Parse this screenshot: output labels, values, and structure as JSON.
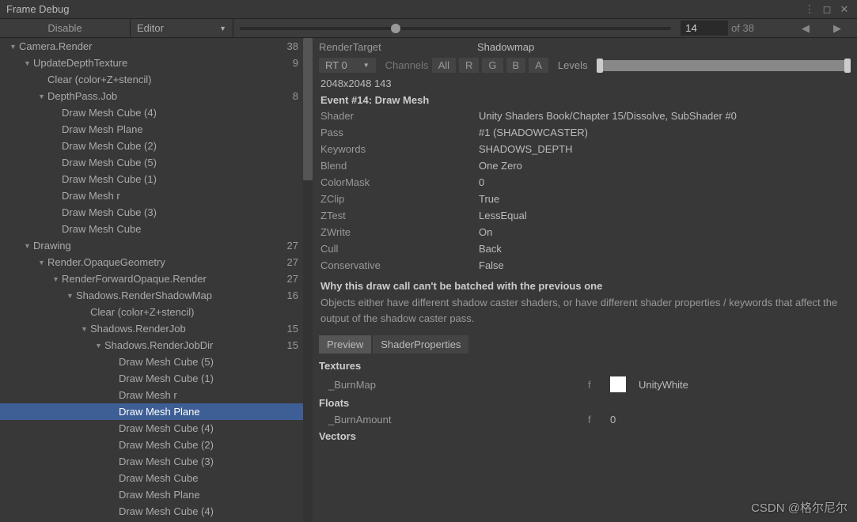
{
  "window": {
    "title": "Frame Debug"
  },
  "toolbar": {
    "disable": "Disable",
    "target": "Editor",
    "current_frame": "14",
    "total_frames": "of 38"
  },
  "tree": [
    {
      "indent": 0,
      "fold": true,
      "label": "Camera.Render",
      "count": "38"
    },
    {
      "indent": 1,
      "fold": true,
      "label": "UpdateDepthTexture",
      "count": "9"
    },
    {
      "indent": 2,
      "fold": false,
      "label": "Clear (color+Z+stencil)",
      "count": ""
    },
    {
      "indent": 2,
      "fold": true,
      "label": "DepthPass.Job",
      "count": "8"
    },
    {
      "indent": 3,
      "fold": false,
      "label": "Draw Mesh Cube (4)",
      "count": ""
    },
    {
      "indent": 3,
      "fold": false,
      "label": "Draw Mesh Plane",
      "count": ""
    },
    {
      "indent": 3,
      "fold": false,
      "label": "Draw Mesh Cube (2)",
      "count": ""
    },
    {
      "indent": 3,
      "fold": false,
      "label": "Draw Mesh Cube (5)",
      "count": ""
    },
    {
      "indent": 3,
      "fold": false,
      "label": "Draw Mesh Cube (1)",
      "count": ""
    },
    {
      "indent": 3,
      "fold": false,
      "label": "Draw Mesh r",
      "count": ""
    },
    {
      "indent": 3,
      "fold": false,
      "label": "Draw Mesh Cube (3)",
      "count": ""
    },
    {
      "indent": 3,
      "fold": false,
      "label": "Draw Mesh Cube",
      "count": ""
    },
    {
      "indent": 1,
      "fold": true,
      "label": "Drawing",
      "count": "27"
    },
    {
      "indent": 2,
      "fold": true,
      "label": "Render.OpaqueGeometry",
      "count": "27"
    },
    {
      "indent": 3,
      "fold": true,
      "label": "RenderForwardOpaque.Render",
      "count": "27"
    },
    {
      "indent": 4,
      "fold": true,
      "label": "Shadows.RenderShadowMap",
      "count": "16"
    },
    {
      "indent": 5,
      "fold": false,
      "label": "Clear (color+Z+stencil)",
      "count": ""
    },
    {
      "indent": 5,
      "fold": true,
      "label": "Shadows.RenderJob",
      "count": "15"
    },
    {
      "indent": 6,
      "fold": true,
      "label": "Shadows.RenderJobDir",
      "count": "15"
    },
    {
      "indent": 7,
      "fold": false,
      "label": "Draw Mesh Cube (5)",
      "count": ""
    },
    {
      "indent": 7,
      "fold": false,
      "label": "Draw Mesh Cube (1)",
      "count": ""
    },
    {
      "indent": 7,
      "fold": false,
      "label": "Draw Mesh r",
      "count": ""
    },
    {
      "indent": 7,
      "fold": false,
      "label": "Draw Mesh Plane",
      "count": "",
      "selected": true
    },
    {
      "indent": 7,
      "fold": false,
      "label": "Draw Mesh Cube (4)",
      "count": ""
    },
    {
      "indent": 7,
      "fold": false,
      "label": "Draw Mesh Cube (2)",
      "count": ""
    },
    {
      "indent": 7,
      "fold": false,
      "label": "Draw Mesh Cube (3)",
      "count": ""
    },
    {
      "indent": 7,
      "fold": false,
      "label": "Draw Mesh Cube",
      "count": ""
    },
    {
      "indent": 7,
      "fold": false,
      "label": "Draw Mesh Plane",
      "count": ""
    },
    {
      "indent": 7,
      "fold": false,
      "label": "Draw Mesh Cube (4)",
      "count": ""
    }
  ],
  "details": {
    "render_target_label": "RenderTarget",
    "render_target_value": "Shadowmap",
    "rt_dropdown": "RT 0",
    "channels_label": "Channels",
    "ch_all": "All",
    "ch_r": "R",
    "ch_g": "G",
    "ch_b": "B",
    "ch_a": "A",
    "levels_label": "Levels",
    "dimensions": "2048x2048 143",
    "event_header": "Event #14: Draw Mesh",
    "props": [
      {
        "k": "Shader",
        "v": "Unity Shaders Book/Chapter 15/Dissolve, SubShader #0"
      },
      {
        "k": "Pass",
        "v": "#1 (SHADOWCASTER)"
      },
      {
        "k": "Keywords",
        "v": "SHADOWS_DEPTH"
      },
      {
        "k": "Blend",
        "v": "One Zero"
      },
      {
        "k": "ColorMask",
        "v": "0"
      },
      {
        "k": "ZClip",
        "v": "True"
      },
      {
        "k": "ZTest",
        "v": "LessEqual"
      },
      {
        "k": "ZWrite",
        "v": "On"
      },
      {
        "k": "Cull",
        "v": "Back"
      },
      {
        "k": "Conservative",
        "v": "False"
      }
    ],
    "batch_header": "Why this draw call can't be batched with the previous one",
    "batch_text": "Objects either have different shadow caster shaders, or have different shader properties / keywords that affect the output of the shadow caster pass.",
    "tabs": {
      "preview": "Preview",
      "shader_props": "ShaderProperties"
    },
    "textures_header": "Textures",
    "textures": [
      {
        "name": "_BurnMap",
        "f": "f",
        "val": "UnityWhite"
      }
    ],
    "floats_header": "Floats",
    "floats": [
      {
        "name": "_BurnAmount",
        "f": "f",
        "val": "0"
      }
    ],
    "vectors_header": "Vectors"
  },
  "watermark": "CSDN @格尔尼尔"
}
